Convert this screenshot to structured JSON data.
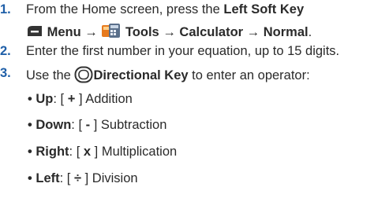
{
  "steps": [
    {
      "num": "1.",
      "line1_a": "From the Home screen, press the ",
      "line1_b": "Left Soft Key",
      "menu": "Menu",
      "arrow1": " → ",
      "tools": "Tools",
      "arrow2": " → ",
      "calculator": "Calculator",
      "arrow3": " → ",
      "normal": "Normal",
      "end": "."
    },
    {
      "num": "2.",
      "text": "Enter the first number in your equation, up to 15 digits."
    },
    {
      "num": "3.",
      "text_a": "Use the ",
      "key": "Directional Key",
      "text_b": " to enter an operator:"
    }
  ],
  "operators": [
    {
      "dir": "Up",
      "sym": "+",
      "name": "Addition"
    },
    {
      "dir": "Down",
      "sym": "-",
      "name": "Subtraction"
    },
    {
      "dir": "Right",
      "sym": "x",
      "name": "Multiplication"
    },
    {
      "dir": "Left",
      "sym": "÷",
      "name": "Division"
    }
  ],
  "bullet": "•",
  "colors": {
    "step_number": "#1f5fa8",
    "text": "#2a2a2a"
  },
  "icons": [
    "left-soft-key-icon",
    "tools-icon",
    "directional-key-icon"
  ]
}
